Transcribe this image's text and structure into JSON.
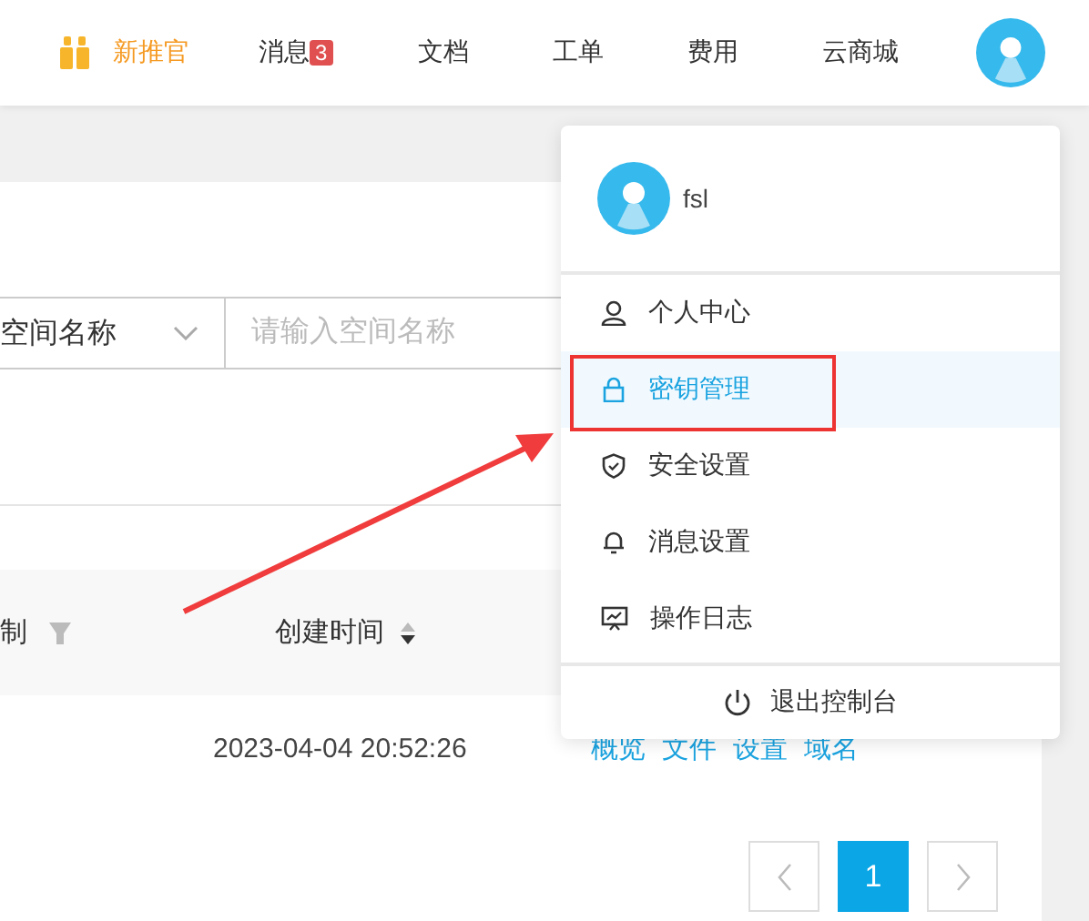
{
  "nav": {
    "promo": "新推官",
    "items": [
      {
        "label": "消息",
        "badge": "3"
      },
      {
        "label": "文档"
      },
      {
        "label": "工单"
      },
      {
        "label": "费用"
      },
      {
        "label": "云商城"
      }
    ]
  },
  "filter": {
    "select": "空间名称",
    "placeholder": "请输入空间名称"
  },
  "table": {
    "columns": [
      {
        "label": "制",
        "kind": "filter"
      },
      {
        "label": "创建时间",
        "kind": "sort"
      }
    ],
    "rows": [
      {
        "created": "2023-04-04 20:52:26",
        "actions": [
          "概览",
          "文件",
          "设置",
          "域名"
        ]
      }
    ]
  },
  "pagination": {
    "pages": [
      {
        "label": "1",
        "selected": true
      }
    ]
  },
  "menu": {
    "user": "fsl",
    "items": [
      {
        "label": "个人中心",
        "kind": "user",
        "selected": false
      },
      {
        "label": "密钥管理",
        "kind": "lock",
        "selected": true
      },
      {
        "label": "安全设置",
        "kind": "shield",
        "selected": false
      },
      {
        "label": "消息设置",
        "kind": "bell",
        "selected": false
      },
      {
        "label": "操作日志",
        "kind": "monitor",
        "selected": false
      }
    ],
    "logout": "退出控制台"
  }
}
